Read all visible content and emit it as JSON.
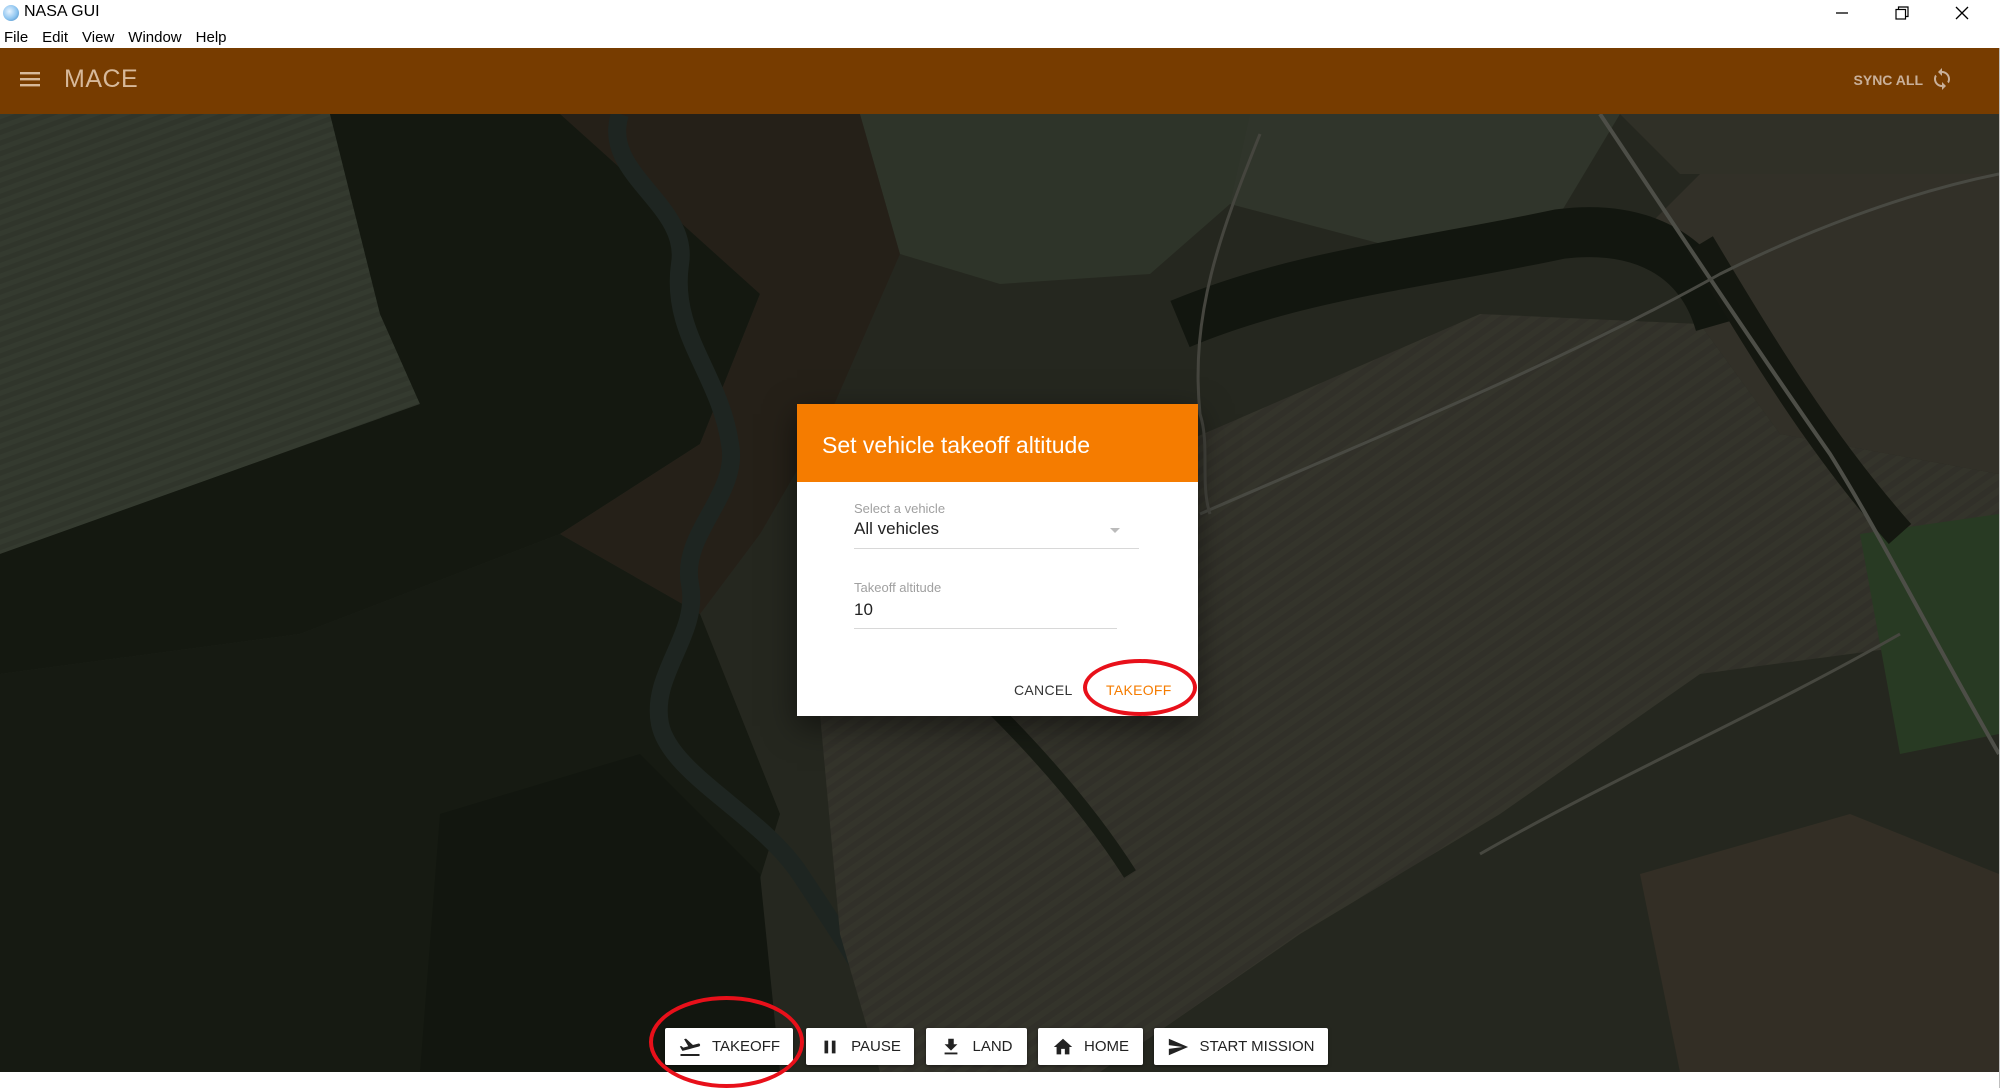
{
  "window": {
    "title": "NASA GUI",
    "icons": [
      "app-globe-icon",
      "minimize-icon",
      "restore-icon",
      "close-icon"
    ]
  },
  "menubar": {
    "items": [
      {
        "label": "File"
      },
      {
        "label": "Edit"
      },
      {
        "label": "View"
      },
      {
        "label": "Window"
      },
      {
        "label": "Help"
      }
    ]
  },
  "appbar": {
    "title": "MACE",
    "sync_label": "SYNC ALL",
    "color": "#773c00",
    "icons": [
      "hamburger-menu-icon",
      "sync-icon"
    ]
  },
  "dialog": {
    "title": "Set vehicle takeoff altitude",
    "header_color": "#f57c00",
    "vehicle_field": {
      "label": "Select a vehicle",
      "value": "All vehicles"
    },
    "altitude_field": {
      "label": "Takeoff altitude",
      "value": "10"
    },
    "cancel_label": "CANCEL",
    "takeoff_label": "TAKEOFF",
    "takeoff_color": "#f57c00"
  },
  "toolbar": {
    "buttons": [
      {
        "label": "TAKEOFF",
        "icon": "takeoff-icon"
      },
      {
        "label": "PAUSE",
        "icon": "pause-icon"
      },
      {
        "label": "LAND",
        "icon": "land-icon"
      },
      {
        "label": "HOME",
        "icon": "home-icon"
      },
      {
        "label": "START MISSION",
        "icon": "send-icon"
      }
    ]
  },
  "annotations": {
    "highlight_color": "#e8101a",
    "highlighted": [
      "dialog-takeoff-button",
      "takeoff-button"
    ]
  }
}
